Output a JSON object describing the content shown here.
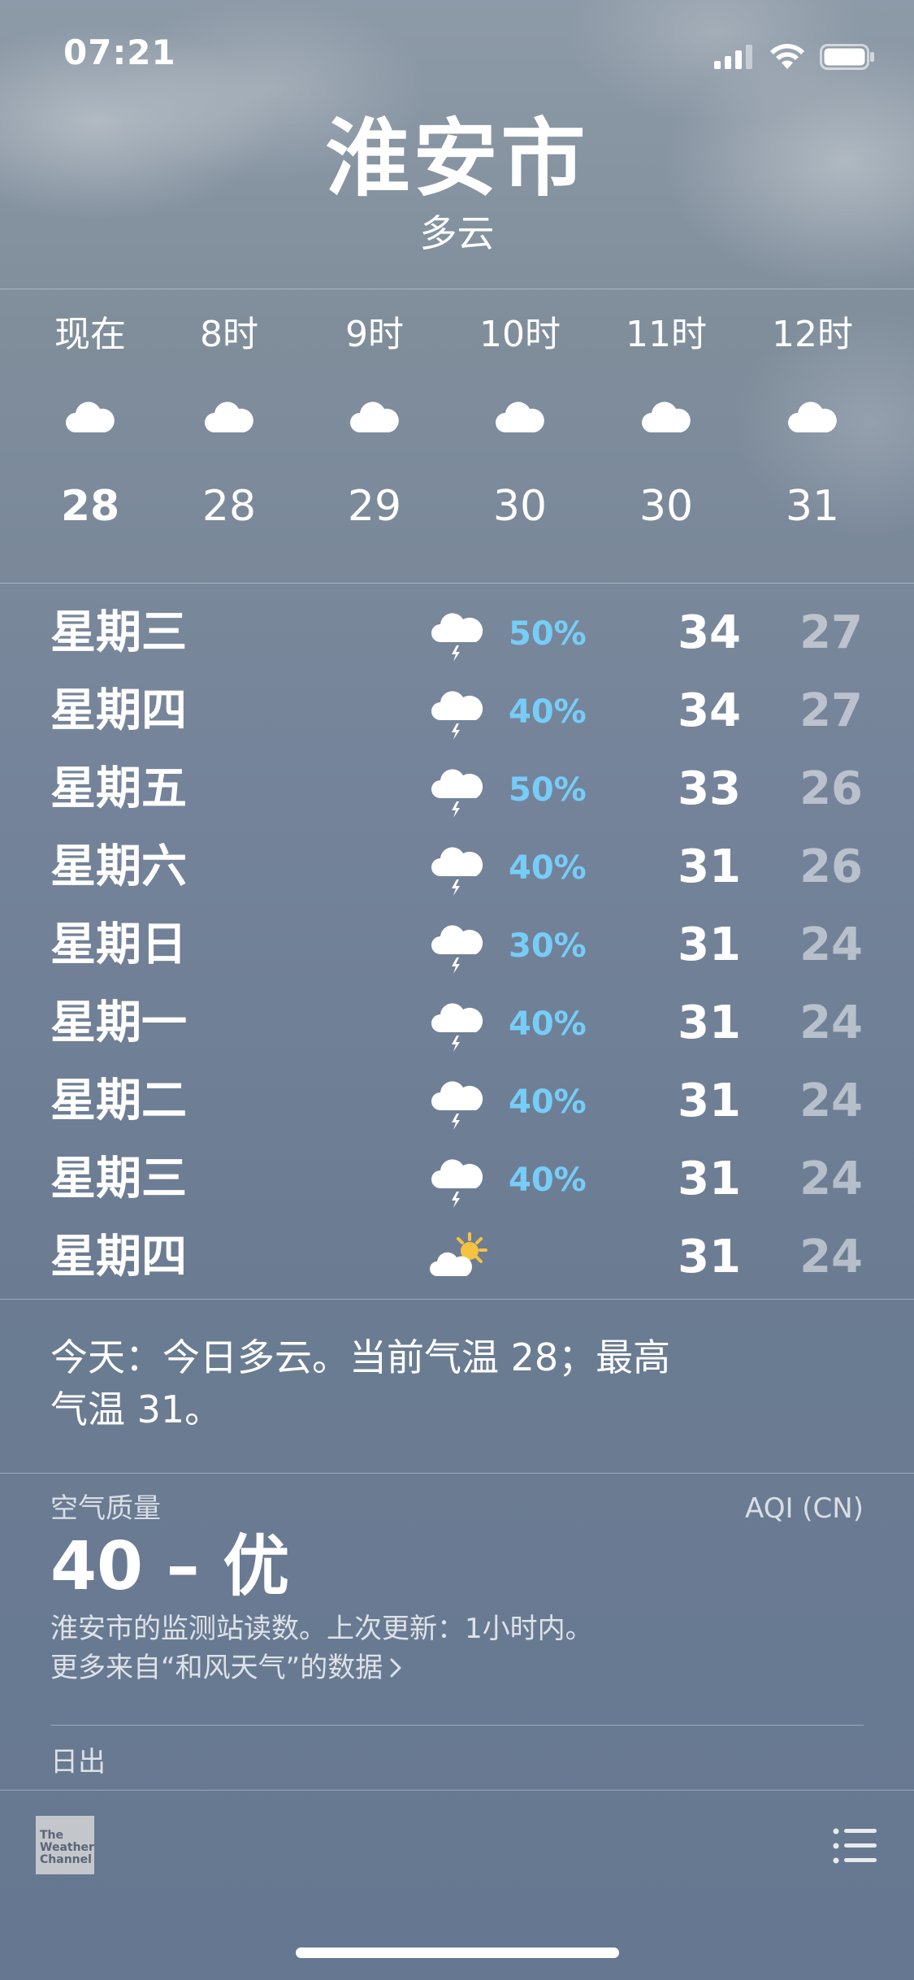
{
  "status_bar": {
    "time": "07:21"
  },
  "location": {
    "city": "淮安市",
    "condition": "多云"
  },
  "hourly": [
    {
      "label": "现在",
      "icon": "cloud-icon",
      "temp": "28"
    },
    {
      "label": "8时",
      "icon": "cloud-icon",
      "temp": "28"
    },
    {
      "label": "9时",
      "icon": "cloud-icon",
      "temp": "29"
    },
    {
      "label": "10时",
      "icon": "cloud-icon",
      "temp": "30"
    },
    {
      "label": "11时",
      "icon": "cloud-icon",
      "temp": "30"
    },
    {
      "label": "12时",
      "icon": "cloud-icon",
      "temp": "31"
    }
  ],
  "daily": [
    {
      "day": "星期三",
      "icon": "thunderstorm-icon",
      "precip": "50%",
      "high": "34",
      "low": "27"
    },
    {
      "day": "星期四",
      "icon": "thunderstorm-icon",
      "precip": "40%",
      "high": "34",
      "low": "27"
    },
    {
      "day": "星期五",
      "icon": "thunderstorm-icon",
      "precip": "50%",
      "high": "33",
      "low": "26"
    },
    {
      "day": "星期六",
      "icon": "thunderstorm-icon",
      "precip": "40%",
      "high": "31",
      "low": "26"
    },
    {
      "day": "星期日",
      "icon": "thunderstorm-icon",
      "precip": "30%",
      "high": "31",
      "low": "24"
    },
    {
      "day": "星期一",
      "icon": "thunderstorm-icon",
      "precip": "40%",
      "high": "31",
      "low": "24"
    },
    {
      "day": "星期二",
      "icon": "thunderstorm-icon",
      "precip": "40%",
      "high": "31",
      "low": "24"
    },
    {
      "day": "星期三",
      "icon": "thunderstorm-icon",
      "precip": "40%",
      "high": "31",
      "low": "24"
    },
    {
      "day": "星期四",
      "icon": "partly-sunny-icon",
      "precip": "",
      "high": "31",
      "low": "24"
    }
  ],
  "summary": {
    "line1": "今天：今日多云。当前气温 28；最高",
    "line2": "气温 31。"
  },
  "air_quality": {
    "label": "空气质量",
    "standard": "AQI (CN)",
    "value": "40 – 优",
    "description": "淮安市的监测站读数。上次更新：1小时内。",
    "source_link": "更多来自“和风天气”的数据"
  },
  "sunrise": {
    "label": "日出"
  },
  "footer": {
    "logo_lines": [
      "The",
      "Weather",
      "Channel"
    ]
  },
  "colors": {
    "precip": "#76cdf8",
    "sun": "#f5c342"
  }
}
